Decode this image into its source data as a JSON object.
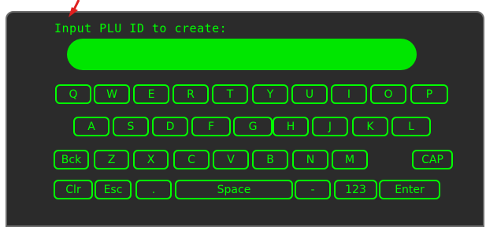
{
  "prompt": "Input PLU ID to create:",
  "input_value": "",
  "accent_color": "#00ff00",
  "arrow_color": "#e0201f",
  "keyboard": {
    "row1": [
      "Q",
      "W",
      "E",
      "R",
      "T",
      "Y",
      "U",
      "I",
      "O",
      "P"
    ],
    "row2": [
      "A",
      "S",
      "D",
      "F",
      "G",
      "H",
      "J",
      "K",
      "L"
    ],
    "row3": [
      "Bck",
      "Z",
      "X",
      "C",
      "V",
      "B",
      "N",
      "M",
      "CAP"
    ],
    "row4": [
      "Clr",
      "Esc",
      ".",
      "Space",
      "-",
      "123",
      "Enter"
    ]
  }
}
